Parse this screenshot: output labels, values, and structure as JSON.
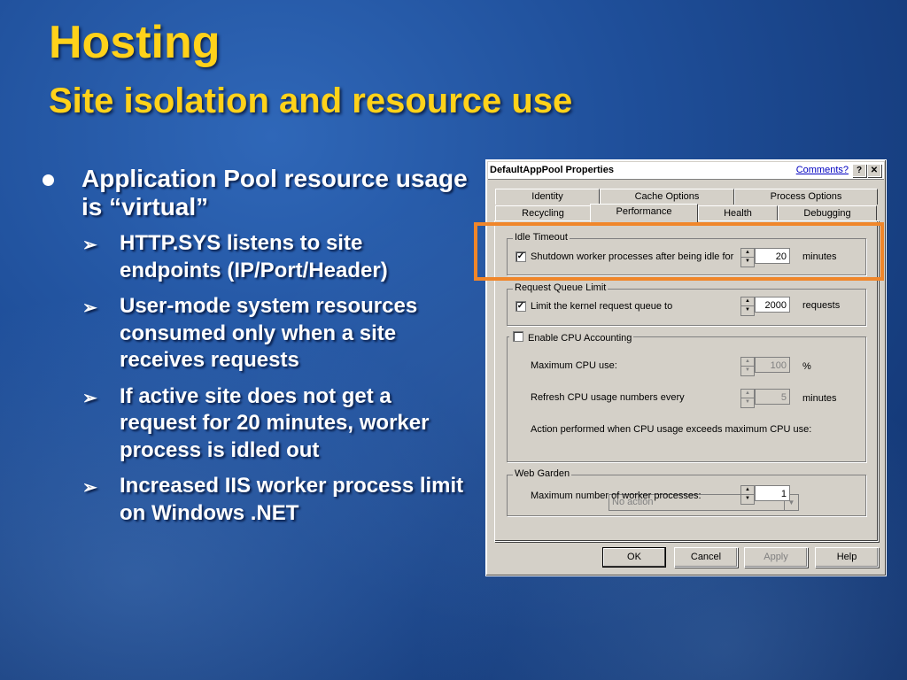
{
  "slide": {
    "title": "Hosting",
    "subtitle": "Site isolation and resource use",
    "main_bullet": "Application Pool resource usage is “virtual”",
    "sub_bullets": [
      "HTTP.SYS listens to site endpoints (IP/Port/Header)",
      "User-mode system resources consumed only when a site receives requests",
      "If active site does not get a request for 20 minutes, worker process is idled out",
      "Increased IIS worker process limit on Windows .NET"
    ],
    "sub_bullet_glyph": "➢",
    "highlight_color": "#f0862a",
    "title_color": "#ffd21a"
  },
  "dialog": {
    "title": "DefaultAppPool Properties",
    "comments_link": "Comments?",
    "help_button": "?",
    "close_button": "✕",
    "tabs_row1": [
      "Identity",
      "Cache Options",
      "Process Options"
    ],
    "tabs_row2": [
      "Recycling",
      "Performance",
      "Health",
      "Debugging"
    ],
    "active_tab": "Performance",
    "idle_timeout": {
      "group_label": "Idle Timeout",
      "checked": true,
      "check_label": "Shutdown worker processes after being idle for",
      "value": "20",
      "unit": "minutes"
    },
    "request_queue": {
      "group_label": "Request Queue Limit",
      "checked": true,
      "check_label": "Limit the kernel request queue to",
      "value": "2000",
      "unit": "requests"
    },
    "cpu": {
      "group_label": "Enable CPU Accounting",
      "checked": false,
      "max_cpu_label": "Maximum CPU use:",
      "max_cpu_value": "100",
      "max_cpu_unit": "%",
      "refresh_label": "Refresh CPU usage numbers every",
      "refresh_value": "5",
      "refresh_unit": "minutes",
      "action_label": "Action performed when CPU usage exceeds maximum CPU use:",
      "action_value": "No action"
    },
    "web_garden": {
      "group_label": "Web Garden",
      "max_label": "Maximum number of worker processes:",
      "max_value": "1"
    },
    "buttons": {
      "ok": "OK",
      "cancel": "Cancel",
      "apply": "Apply",
      "help": "Help"
    }
  }
}
